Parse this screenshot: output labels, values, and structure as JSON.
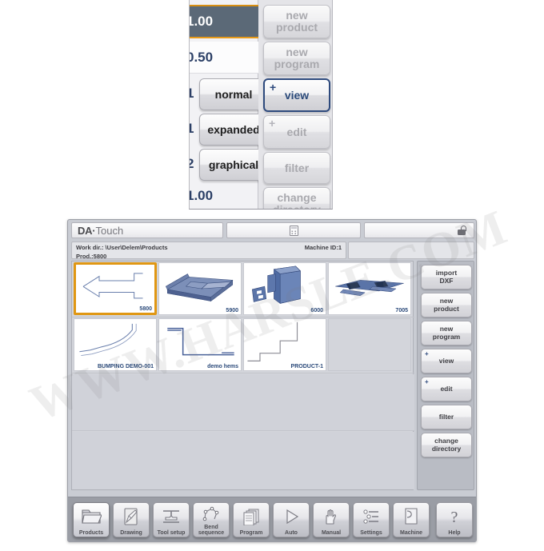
{
  "popup": {
    "values": [
      {
        "text": "1.00",
        "selected": true
      },
      {
        "text": "0.50",
        "selected": false
      },
      {
        "text": "1",
        "selected": false
      },
      {
        "text": "1",
        "selected": false
      },
      {
        "text": "2",
        "selected": false
      },
      {
        "text": "1.00",
        "selected": false
      }
    ],
    "mode_buttons": [
      {
        "label": "normal",
        "state": "enabled"
      },
      {
        "label": "expanded",
        "state": "enabled"
      },
      {
        "label": "graphical",
        "state": "enabled"
      }
    ],
    "action_buttons": [
      {
        "label": "new\nproduct",
        "line1": "new",
        "line2": "product",
        "state": "disabled",
        "plus": false
      },
      {
        "label": "new\nprogram",
        "line1": "new",
        "line2": "program",
        "state": "disabled",
        "plus": false
      },
      {
        "label": "view",
        "line1": "view",
        "line2": "",
        "state": "selected",
        "plus": true
      },
      {
        "label": "edit",
        "line1": "edit",
        "line2": "",
        "state": "disabled",
        "plus": true
      },
      {
        "label": "filter",
        "line1": "filter",
        "line2": "",
        "state": "disabled",
        "plus": false
      },
      {
        "label": "change directory",
        "line1": "change",
        "line2": "directory",
        "state": "disabled",
        "plus": false
      }
    ]
  },
  "watermark": {
    "text": "WWW.HARSLE.COM"
  },
  "app": {
    "header": {
      "logo_bold": "DA",
      "logo_dot": "·",
      "logo_light": "Touch",
      "calc_icon": "calculator-icon",
      "lock_icon": "unlocked-padlock-icon"
    },
    "info": {
      "work_dir_label": "Work dir.:",
      "work_dir_value": "\\User\\Delem\\Products",
      "machine_id": "Machine ID:1",
      "product_label": "Prod.:5800"
    },
    "thumbnails": [
      {
        "id": "5800",
        "caption": "",
        "selected": true,
        "art": "profile-arrow",
        "row": 0,
        "col": 0
      },
      {
        "id": "5900",
        "caption": "",
        "selected": false,
        "art": "tray-3d",
        "row": 0,
        "col": 1
      },
      {
        "id": "6000",
        "caption": "",
        "selected": false,
        "art": "cabinet-3d",
        "row": 0,
        "col": 2
      },
      {
        "id": "7005",
        "caption": "",
        "selected": false,
        "art": "panel-3d",
        "row": 0,
        "col": 3
      },
      {
        "id": "",
        "caption": "BUMPING DEMO-001",
        "selected": false,
        "art": "bump-curve",
        "row": 1,
        "col": 0
      },
      {
        "id": "",
        "caption": "demo hems",
        "selected": false,
        "art": "hem-profile",
        "row": 1,
        "col": 1
      },
      {
        "id": "",
        "caption": "PRODUCT-1",
        "selected": false,
        "art": "step-profile",
        "row": 1,
        "col": 2
      },
      {
        "id": "",
        "caption": "",
        "selected": false,
        "art": "",
        "row": 1,
        "col": 3
      }
    ],
    "side_buttons": [
      {
        "line1": "import",
        "line2": "DXF",
        "plus": false
      },
      {
        "line1": "new",
        "line2": "product",
        "plus": false
      },
      {
        "line1": "new",
        "line2": "program",
        "plus": false
      },
      {
        "line1": "view",
        "line2": "",
        "plus": true
      },
      {
        "line1": "edit",
        "line2": "",
        "plus": true
      },
      {
        "line1": "filter",
        "line2": "",
        "plus": false
      },
      {
        "line1": "change",
        "line2": "directory",
        "plus": false
      }
    ],
    "toolbar": [
      {
        "label": "Products",
        "line1": "Products",
        "line2": "",
        "icon": "folder-icon",
        "active": true
      },
      {
        "label": "Drawing",
        "line1": "Drawing",
        "line2": "",
        "icon": "pencil-page-icon",
        "active": false
      },
      {
        "label": "Tool setup",
        "line1": "Tool setup",
        "line2": "",
        "icon": "tool-press-icon",
        "active": false
      },
      {
        "label": "Bend sequence",
        "line1": "Bend",
        "line2": "sequence",
        "icon": "bend-sequence-icon",
        "active": false
      },
      {
        "label": "Program",
        "line1": "Program",
        "line2": "",
        "icon": "pages-stack-icon",
        "active": false
      },
      {
        "label": "Auto",
        "line1": "Auto",
        "line2": "",
        "icon": "play-triangle-icon",
        "active": false
      },
      {
        "label": "Manual",
        "line1": "Manual",
        "line2": "",
        "icon": "hand-icon",
        "active": false
      },
      {
        "label": "Settings",
        "line1": "Settings",
        "line2": "",
        "icon": "sliders-list-icon",
        "active": false
      },
      {
        "label": "Machine",
        "line1": "Machine",
        "line2": "",
        "icon": "machine-page-icon",
        "active": false
      },
      {
        "label": "Help",
        "line1": "Help",
        "line2": "",
        "icon": "question-mark-icon",
        "active": false
      }
    ]
  },
  "colors": {
    "selection_orange": "#e09713",
    "selection_blue": "#2e4a7d",
    "thumb_blue": "#5a74a8",
    "text_blue": "#2b4a7a",
    "window_gray": "#c9ccd3",
    "toolbar_gray": "#9a9da5"
  }
}
